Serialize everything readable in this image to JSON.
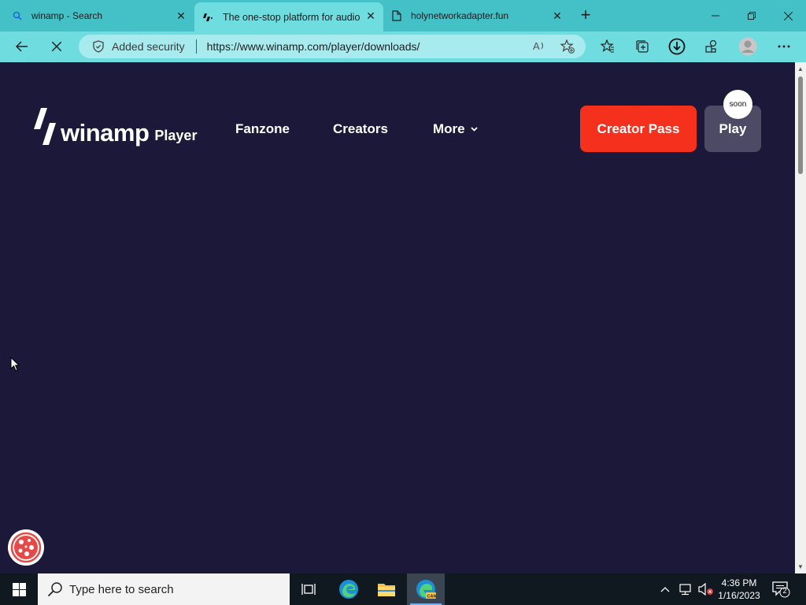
{
  "browser": {
    "tabs": [
      {
        "title": "winamp - Search",
        "icon": "search-icon"
      },
      {
        "title": "The one-stop platform for audio",
        "icon": "winamp-favicon",
        "active": true
      },
      {
        "title": "holynetworkadapter.fun",
        "icon": "page-icon"
      }
    ],
    "new_tab": "+",
    "address": {
      "security_label": "Added security",
      "url": "https://www.winamp.com/player/downloads/"
    }
  },
  "site": {
    "logo_wordmark": "winamp",
    "logo_product": "Player",
    "nav": {
      "fanzone": "Fanzone",
      "creators": "Creators",
      "more": "More"
    },
    "creator_pass_label": "Creator Pass",
    "play_label": "Play",
    "soon_badge": "soon"
  },
  "taskbar": {
    "search_placeholder": "Type here to search",
    "time": "4:36 PM",
    "date": "1/16/2023",
    "notification_count": "2"
  },
  "colors": {
    "page_bg": "#1c1839",
    "tab_bar": "#44c1c7",
    "active_tab": "#6fdce0",
    "creator_pass": "#f5301c",
    "play_button": "#4d4a66"
  }
}
